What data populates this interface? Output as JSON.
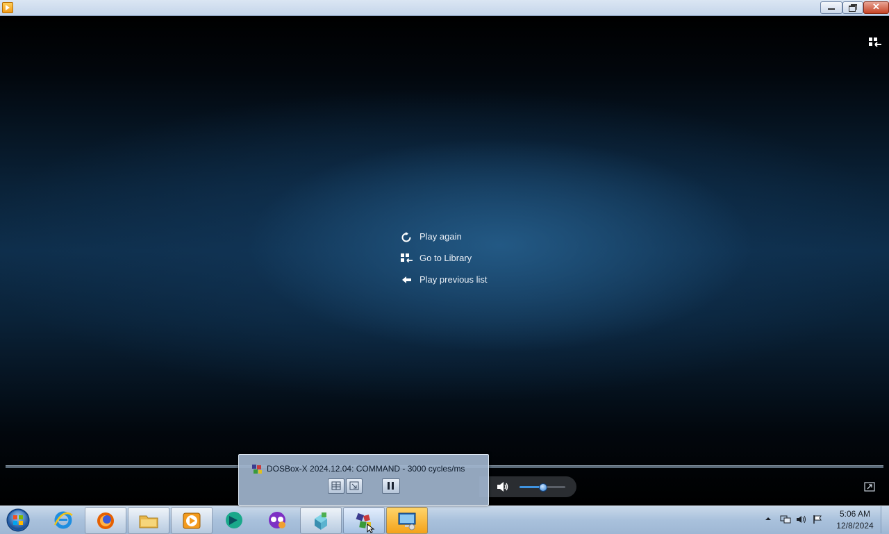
{
  "window": {
    "app_icon": "media-player-icon",
    "controls": [
      "minimize-icon",
      "restore-icon",
      "close-icon"
    ],
    "close_glyph": "✕"
  },
  "player": {
    "menu": [
      {
        "label": "Play again",
        "icon": "replay-icon"
      },
      {
        "label": "Go to Library",
        "icon": "library-icon"
      },
      {
        "label": "Play previous list",
        "icon": "back-arrow-icon"
      }
    ],
    "volume_level": 0.5,
    "accent_color": "#3f93e0"
  },
  "thumbnail": {
    "title": "DOSBox-X 2024.12.04: COMMAND - 3000 cycles/ms",
    "buttons": [
      "library-icon",
      "switch-view-icon",
      "pause-icon"
    ]
  },
  "taskbar": {
    "apps": [
      "firefox-icon",
      "file-explorer-icon",
      "media-player-icon",
      "bing-icon",
      "tor-browser-icon",
      "package-icon",
      "dosbox-icon",
      "remote-desktop-icon"
    ],
    "pinned": [
      "internet-explorer-icon"
    ],
    "tray_icons": [
      "network-icon",
      "volume-icon",
      "action-center-flag-icon"
    ],
    "clock": {
      "time": "5:06 AM",
      "date": "12/8/2024"
    }
  }
}
